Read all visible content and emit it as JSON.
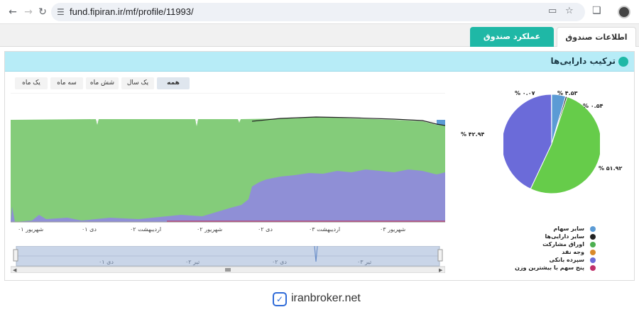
{
  "browser": {
    "url": "fund.fipiran.ir/mf/profile/11993/",
    "icons": [
      "back-icon",
      "forward-icon",
      "reload-icon",
      "site-settings-icon",
      "install-icon",
      "bookmark-star-icon",
      "extensions-icon",
      "profile-avatar"
    ]
  },
  "tabs": [
    {
      "label": "اطلاعات صندوق",
      "active": false
    },
    {
      "label": "عملکرد صندوق",
      "active": true
    }
  ],
  "panel": {
    "title": "ترکیب دارایی‌ها"
  },
  "range_buttons": [
    {
      "label": "همه",
      "active": true
    },
    {
      "label": "یک سال",
      "active": false
    },
    {
      "label": "شش ماه",
      "active": false
    },
    {
      "label": "سه ماه",
      "active": false
    },
    {
      "label": "یک ماه",
      "active": false
    }
  ],
  "chart_data": [
    {
      "type": "area",
      "stacked": true,
      "x_ticks": [
        "شهریور ۰۱",
        "دی ۰۱",
        "اردیبهشت ۰۲",
        "شهریور ۰۲",
        "دی ۰۲",
        "اردیبهشت ۰۳",
        "شهریور ۰۳"
      ],
      "navigator_ticks": [
        "دی ۰۱",
        "تیر ۰۲",
        "دی ۰۲",
        "تیر ۰۳"
      ],
      "series": [
        {
          "name": "سپرده بانکی",
          "color": "#8f8fd6"
        },
        {
          "name": "اوراق مشارکت",
          "color": "#84cc7a"
        },
        {
          "name": "سایر سهام",
          "color": "#5b9bd5"
        },
        {
          "name": "سایر دارایی‌ها",
          "color": "#222222"
        }
      ]
    },
    {
      "type": "pie",
      "slices": [
        {
          "name": "سایر سهام",
          "value": 4.53,
          "label": "% ۴.۵۳",
          "color": "#5b9bd5"
        },
        {
          "name": "سایر دارایی‌ها",
          "value": 0.54,
          "label": "% ۰.۵۴",
          "color": "#222222"
        },
        {
          "name": "اوراق مشارکت",
          "value": 51.92,
          "label": "% ۵۱.۹۲",
          "color": "#66cc4a"
        },
        {
          "name": "سپرده بانکی",
          "value": 42.94,
          "label": "% ۴۲.۹۴",
          "color": "#6b6bd9"
        },
        {
          "name": "پنج سهم با بیشترین وزن",
          "value": 0.07,
          "label": "% ۰.۰۷",
          "color": "#c0306a"
        }
      ]
    }
  ],
  "legend": [
    {
      "label": "سایر سهام",
      "color": "#5b9bd5"
    },
    {
      "label": "سایر دارایی‌ها",
      "color": "#222222"
    },
    {
      "label": "اوراق مشارکت",
      "color": "#4caf50"
    },
    {
      "label": "وجه نقد",
      "color": "#d98a2b"
    },
    {
      "label": "سپرده بانکی",
      "color": "#6b6bd9"
    },
    {
      "label": "پنج سهم با بیشترین وزن",
      "color": "#c0306a"
    }
  ],
  "footer": {
    "brand": "iranbroker.net"
  }
}
